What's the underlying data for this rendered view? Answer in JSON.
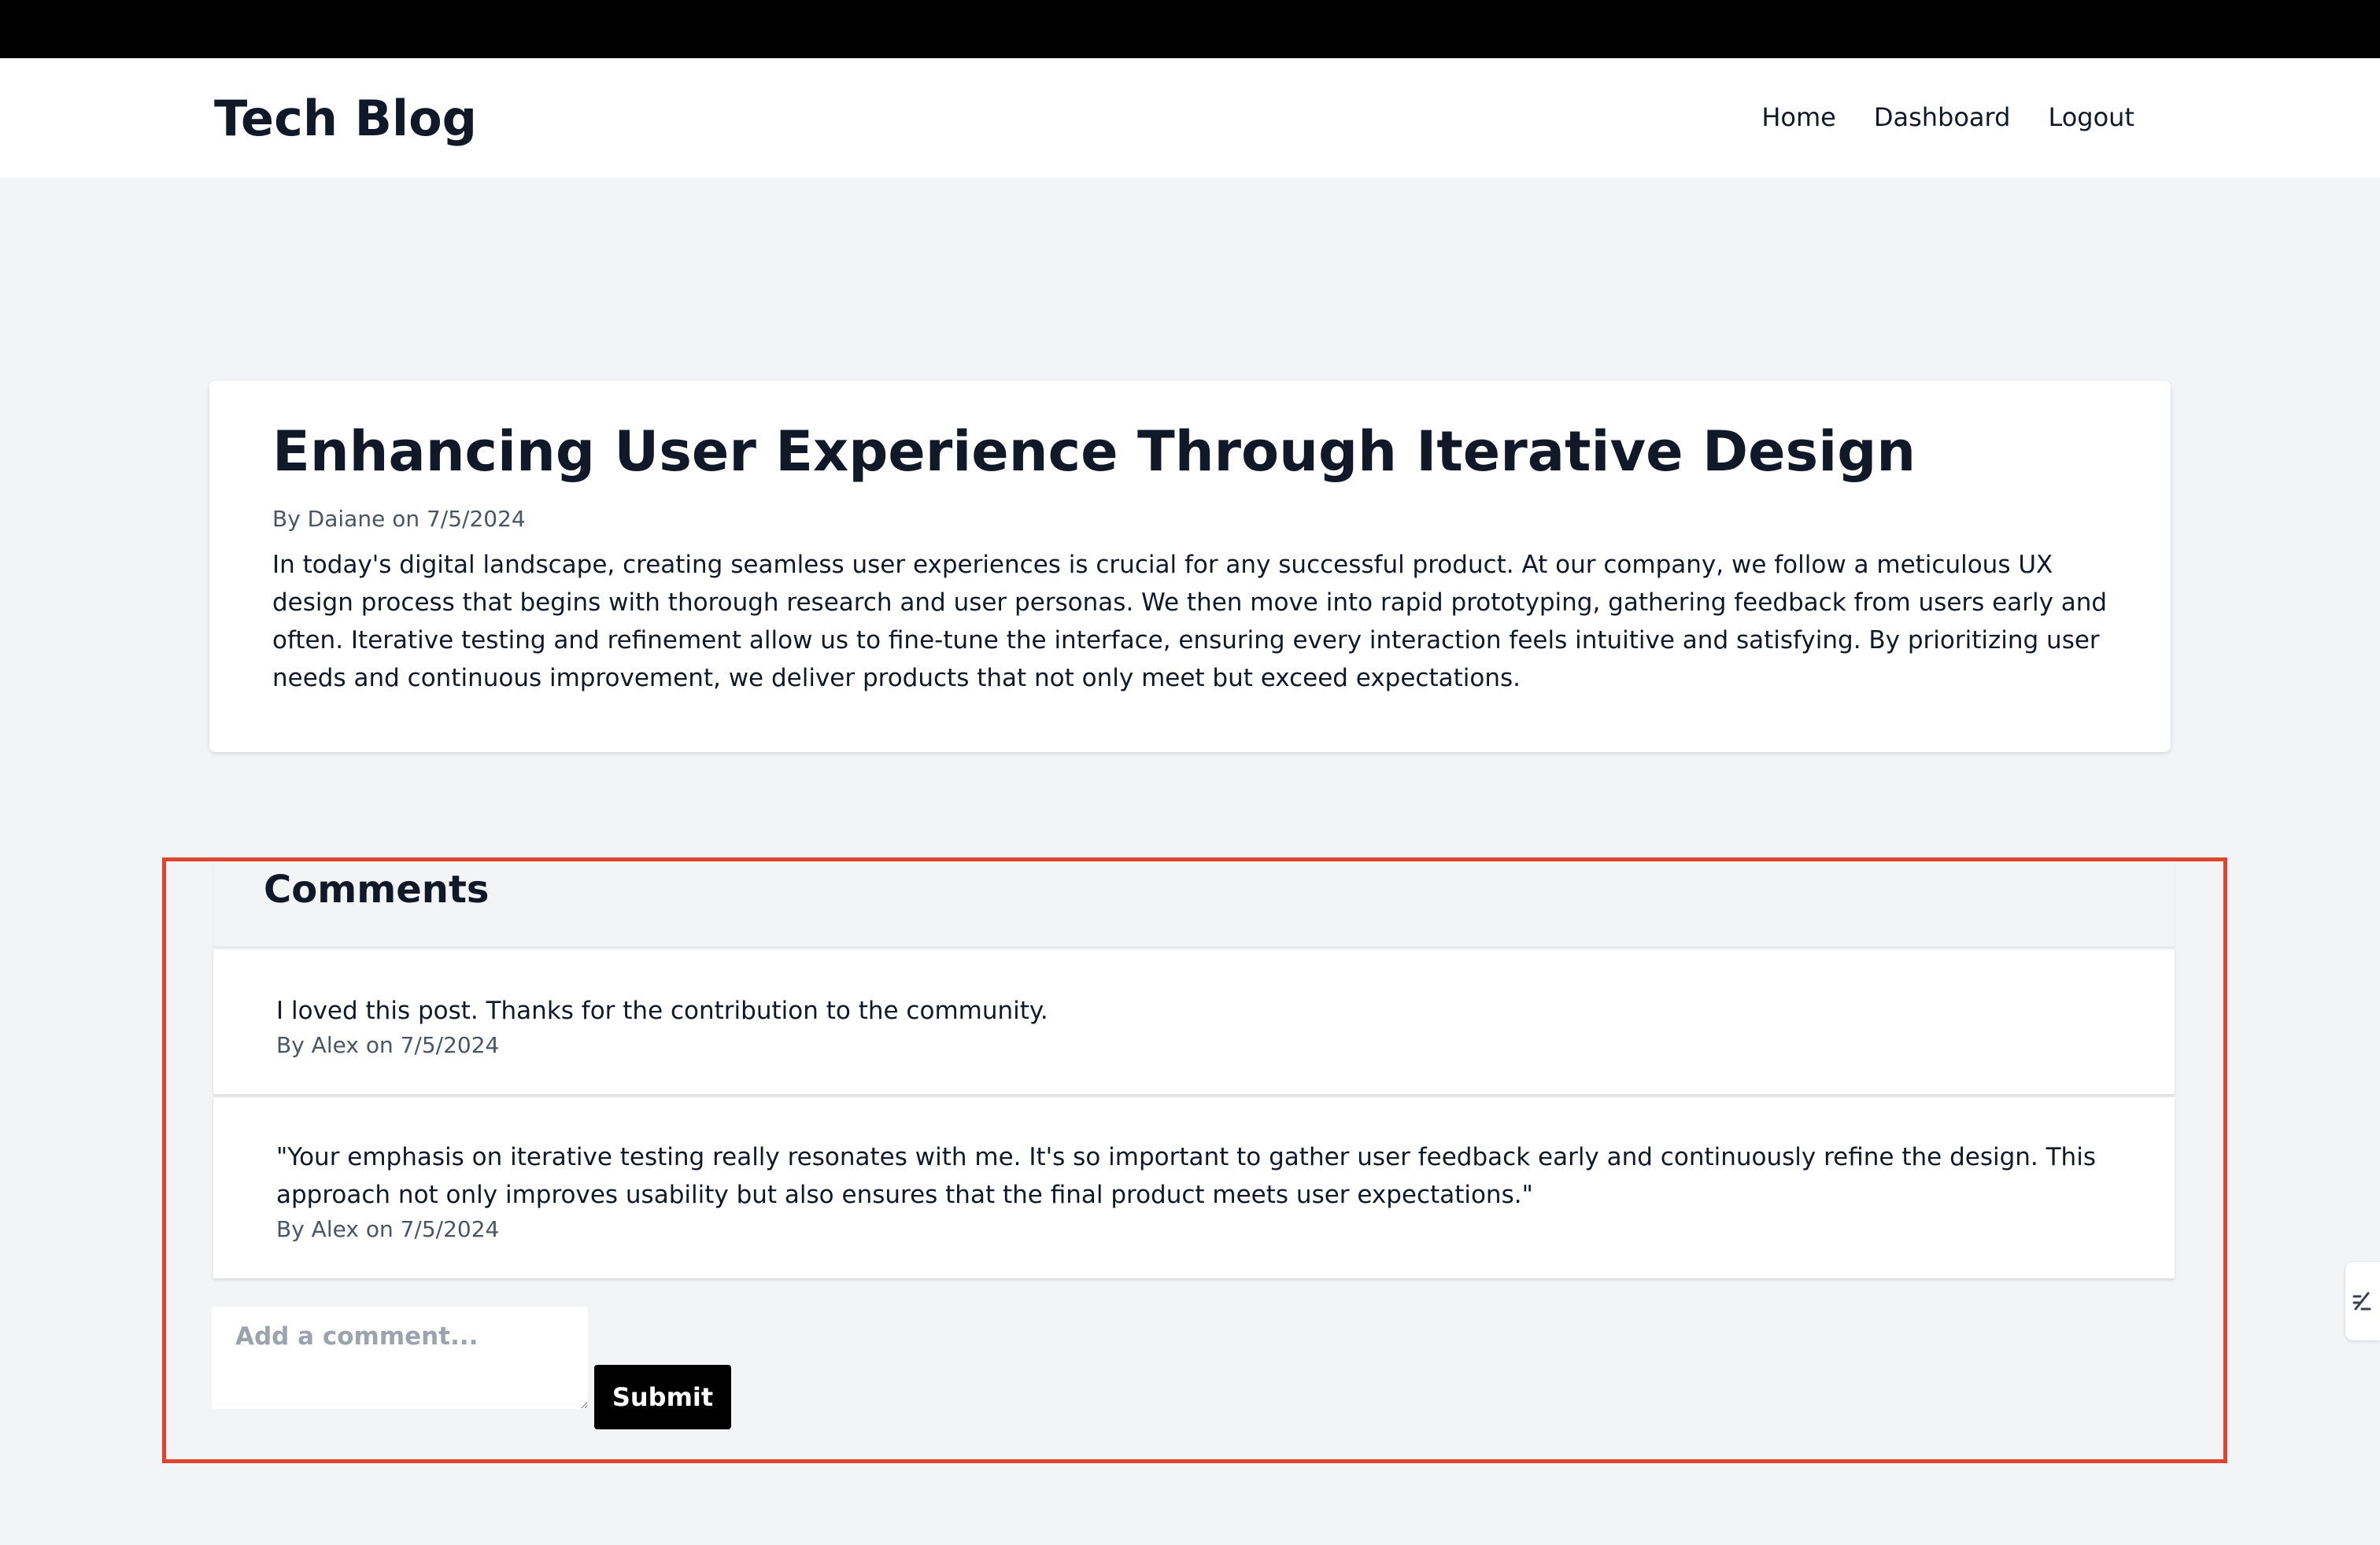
{
  "header": {
    "brand": "Tech Blog",
    "nav": [
      {
        "label": "Home"
      },
      {
        "label": "Dashboard"
      },
      {
        "label": "Logout"
      }
    ]
  },
  "post": {
    "title": "Enhancing User Experience Through Iterative Design",
    "meta": "By Daiane on 7/5/2024",
    "body": "In today's digital landscape, creating seamless user experiences is crucial for any successful product. At our company, we follow a meticulous UX design process that begins with thorough research and user personas. We then move into rapid prototyping, gathering feedback from users early and often. Iterative testing and refinement allow us to fine-tune the interface, ensuring every interaction feels intuitive and satisfying. By prioritizing user needs and continuous improvement, we deliver products that not only meet but exceed expectations."
  },
  "comments": {
    "title": "Comments",
    "items": [
      {
        "text": "I loved this post. Thanks for the contribution to the community.",
        "meta": "By Alex on 7/5/2024"
      },
      {
        "text": "\"Your emphasis on iterative testing really resonates with me. It's so important to gather user feedback early and continuously refine the design. This approach not only improves usability but also ensures that the final product meets user expectations.\"",
        "meta": "By Alex on 7/5/2024"
      }
    ],
    "input_placeholder": "Add a comment...",
    "submit_label": "Submit"
  },
  "colors": {
    "page_background": "#f3f4f6",
    "highlight_border": "#e0462f",
    "button": "#000000"
  },
  "icons": {
    "side_widget": "edit-pen-icon"
  }
}
